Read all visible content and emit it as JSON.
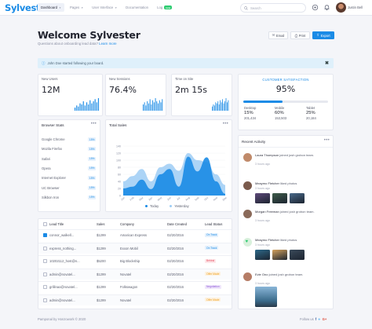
{
  "topbar": {
    "logo": "Sylvester",
    "nav": [
      {
        "label": "Dashboard",
        "active": true,
        "caret": true
      },
      {
        "label": "Pages",
        "caret": true
      },
      {
        "label": "User Interface",
        "caret": true
      },
      {
        "label": "Documentation"
      },
      {
        "label": "Log",
        "badge": "new"
      }
    ],
    "search_placeholder": "Search",
    "user_name": "Justin Bell"
  },
  "header": {
    "title": "Welcome Sylvester",
    "subtitle": "Questions about onboarding lead data?",
    "subtitle_link": "Learn more",
    "email_label": "Email",
    "print_label": "Print",
    "export_label": "Export"
  },
  "alert": {
    "text": "John Doe started following your board."
  },
  "stats": [
    {
      "label": "New Users",
      "value": "12M",
      "bars": [
        3,
        5,
        4,
        7,
        6,
        9,
        5,
        8,
        6,
        10,
        7,
        9,
        11,
        8,
        12
      ]
    },
    {
      "label": "New Sessions",
      "value": "76.4%",
      "bars": [
        6,
        8,
        5,
        9,
        7,
        11,
        6,
        10,
        8,
        12,
        9,
        7,
        10,
        8,
        11
      ]
    },
    {
      "label": "Time on Site",
      "value": "2m 15s",
      "bars": [
        4,
        6,
        5,
        8,
        7,
        9,
        6,
        10,
        8,
        11,
        7,
        9,
        12,
        8,
        10
      ]
    }
  ],
  "csat": {
    "title": "CUSTOMER SATISFACTION",
    "value": "95%",
    "progress": 0.46,
    "cols": [
      {
        "label": "Desktop",
        "pct": "15%",
        "num": "201,434"
      },
      {
        "label": "Mobile",
        "pct": "60%",
        "num": "153,503"
      },
      {
        "label": "Tablet",
        "pct": "25%",
        "num": "20,184"
      }
    ]
  },
  "browser_stats": {
    "title": "Browser Stats",
    "rows": [
      {
        "name": "Google Chrome",
        "pct": "15%"
      },
      {
        "name": "Mozila Firefox",
        "pct": "15%"
      },
      {
        "name": "Safari",
        "pct": "15%"
      },
      {
        "name": "Opera",
        "pct": "15%"
      },
      {
        "name": "Internet Explorer",
        "pct": "15%"
      },
      {
        "name": "UC Browser",
        "pct": "15%"
      },
      {
        "name": "Silkbon Iron",
        "pct": "15%"
      }
    ]
  },
  "total_sales": {
    "title": "Total Sales",
    "legend": [
      "Today",
      "Yesterday"
    ]
  },
  "chart_data": {
    "type": "area",
    "title": "Total Sales",
    "x": [
      "Jan",
      "Feb",
      "Mar",
      "Apr",
      "May",
      "Jun",
      "Jul",
      "Aug",
      "Sep",
      "Oct",
      "Nov",
      "Dec"
    ],
    "ylim": [
      0,
      160
    ],
    "yticks": [
      0,
      20,
      40,
      60,
      80,
      100,
      120,
      140
    ],
    "series": [
      {
        "name": "Today",
        "values": [
          20,
          25,
          45,
          18,
          60,
          75,
          25,
          110,
          68,
          108,
          40,
          5
        ],
        "color": "#1a8be6"
      },
      {
        "name": "Yesterday",
        "values": [
          40,
          55,
          75,
          40,
          80,
          90,
          70,
          120,
          100,
          95,
          60,
          30
        ],
        "color": "#9dcdf5"
      }
    ]
  },
  "recent_activity": {
    "title": "Recent Activity",
    "items": [
      {
        "name": "Laura Thompson",
        "action": "joined josh grobon team.",
        "time": "3 hours ago",
        "avatar_color": "#c08a6a"
      },
      {
        "name": "Meaymo Fletcher",
        "action": "liked photos",
        "time": "3 hours ago",
        "avatar_color": "#7a5a4c"
      },
      {
        "name": "Morgan Freeman",
        "action": "joined josh grobon team.",
        "time": "3 hours ago",
        "avatar_color": "#8a6a5a"
      },
      {
        "name": "Meaymo Fletcher",
        "action": "liked photos",
        "time": "3 hours ago",
        "avatar_color": "#d8f0dc"
      },
      {
        "name": "Evie Ono",
        "action": "joined josh grobon team.",
        "time": "3 hours ago",
        "avatar_color": "#b57c66"
      }
    ]
  },
  "leads": {
    "headers": [
      "Lead Title",
      "Sales",
      "Company",
      "Date Created",
      "Lead Status"
    ],
    "rows": [
      {
        "title": "connor_walkell...",
        "sales": "$1299",
        "company": "Amarican Express",
        "date": "02/20/2016",
        "status": "On Track",
        "status_color": "#1a8be6",
        "status_bg": "#e3f0fc",
        "checked": true
      },
      {
        "title": "express_nothing...",
        "sales": "$1299",
        "company": "Exxon Mobil",
        "date": "02/20/2016",
        "status": "On Track",
        "status_color": "#1a8be6",
        "status_bg": "#e3f0fc",
        "checked": false
      },
      {
        "title": "10202112_host@n...",
        "sales": "$5200",
        "company": "Big Blockship",
        "date": "02/20/2016",
        "status": "Behind",
        "status_color": "#e74c5e",
        "status_bg": "#fde6e9",
        "checked": false
      },
      {
        "title": "admin@novatel...",
        "sales": "$1299",
        "company": "Novatel",
        "date": "02/20/2016",
        "status": "Offer Made",
        "status_color": "#f0a020",
        "status_bg": "#fdf1de",
        "checked": false
      },
      {
        "title": "grillinao@novatel...",
        "sales": "$1299",
        "company": "Folkswagon",
        "date": "02/20/2016",
        "status": "Negotiation",
        "status_color": "#8e5ad8",
        "status_bg": "#efe6fb",
        "checked": false
      },
      {
        "title": "admin@novatel...",
        "sales": "$1299",
        "company": "Novatel",
        "date": "02/20/2016",
        "status": "Offer Made",
        "status_color": "#f0a020",
        "status_bg": "#fdf1de",
        "checked": false
      }
    ]
  },
  "footer": {
    "left": "Pamponal by Honzowork © 2020",
    "right": "Follow us"
  }
}
